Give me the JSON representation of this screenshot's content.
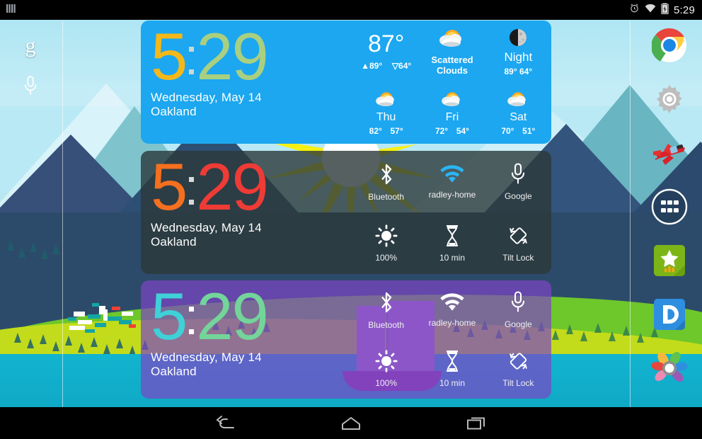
{
  "status_bar": {
    "left_icon": "signal-bars-icon",
    "alarm_icon": "alarm-clock-icon",
    "wifi_icon": "wifi-icon",
    "battery_icon": "battery-charging-icon",
    "time": "5:29"
  },
  "nav_bar": {
    "back_label": "Back",
    "home_label": "Home",
    "recents_label": "Recent apps"
  },
  "left_dock": {
    "items": [
      {
        "icon": "google-g-icon",
        "label": "Google Search"
      },
      {
        "icon": "microphone-icon",
        "label": "Voice Search"
      }
    ]
  },
  "right_dock": {
    "items": [
      {
        "icon": "chrome-icon",
        "label": "Chrome"
      },
      {
        "icon": "settings-gear-icon",
        "label": "Settings"
      },
      {
        "icon": "airplane-icon",
        "label": "Airplane"
      },
      {
        "icon": "app-drawer-icon",
        "label": "Apps"
      },
      {
        "icon": "star-chart-icon",
        "label": "Ratings"
      },
      {
        "icon": "letter-d-icon",
        "label": "D App"
      },
      {
        "icon": "color-petals-icon",
        "label": "Gallery"
      }
    ]
  },
  "widgets": [
    {
      "id": "weather-widget",
      "theme": "blue",
      "clock": {
        "hours": "5",
        "minutes": "29",
        "separator": ":"
      },
      "date": "Wednesday, May 14",
      "city": "Oakland",
      "colors": {
        "background": "#1ca7f0",
        "hours": "#f5b819",
        "minutes": "#a9cf80"
      },
      "weather": {
        "current_temp": "87°",
        "high_label": "▲89°",
        "low_label": "▽64°",
        "condition": "Scattered Clouds",
        "condition_icon": "sun-behind-cloud-icon",
        "period_icon": "moon-icon",
        "period_label": "Night",
        "period_temps": "89°  64°",
        "forecast": [
          {
            "day": "Thu",
            "icon": "sun-behind-cloud-icon",
            "high": "82°",
            "low": "57°"
          },
          {
            "day": "Fri",
            "icon": "sun-behind-cloud-icon",
            "high": "72°",
            "low": "54°"
          },
          {
            "day": "Sat",
            "icon": "sun-behind-cloud-icon",
            "high": "70°",
            "low": "51°"
          }
        ]
      }
    },
    {
      "id": "toggles-widget-dark",
      "theme": "dark",
      "clock": {
        "hours": "5",
        "minutes": "29",
        "separator": ":"
      },
      "date": "Wednesday, May 14",
      "city": "Oakland",
      "colors": {
        "background": "rgba(44,56,58,0.80)",
        "hours": "#f4701f",
        "minutes": "#ef3b36"
      },
      "toggles": [
        {
          "icon": "bluetooth-icon",
          "label": "Bluetooth"
        },
        {
          "icon": "wifi-icon",
          "label": "radley-home"
        },
        {
          "icon": "microphone-icon",
          "label": "Google"
        },
        {
          "icon": "brightness-sun-icon",
          "label": "100%"
        },
        {
          "icon": "hourglass-icon",
          "label": "10 min"
        },
        {
          "icon": "rotation-lock-icon",
          "label": "Tilt Lock"
        }
      ]
    },
    {
      "id": "toggles-widget-purple",
      "theme": "purple",
      "clock": {
        "hours": "5",
        "minutes": "29",
        "separator": ":"
      },
      "date": "Wednesday, May 14",
      "city": "Oakland",
      "colors": {
        "background": "rgba(126,68,196,0.70)",
        "hours": "#3fd0d8",
        "minutes": "#73d59a"
      },
      "toggles": [
        {
          "icon": "bluetooth-icon",
          "label": "Bluetooth"
        },
        {
          "icon": "wifi-icon",
          "label": "radley-home"
        },
        {
          "icon": "microphone-icon",
          "label": "Google"
        },
        {
          "icon": "brightness-sun-icon",
          "label": "100%"
        },
        {
          "icon": "hourglass-icon",
          "label": "10 min"
        },
        {
          "icon": "rotation-lock-icon",
          "label": "Tilt Lock"
        }
      ]
    }
  ],
  "wallpaper": {
    "description": "Flat design mountain landscape with sun, green hills, village and sailboat",
    "colors": {
      "sky": "#bfeaf3",
      "sun": "#f6f013",
      "mountain_navy": "#2d4f73",
      "hill_green": "#6ec72b",
      "hill_lime": "#c2dc1b",
      "water": "#12b4cf"
    }
  }
}
